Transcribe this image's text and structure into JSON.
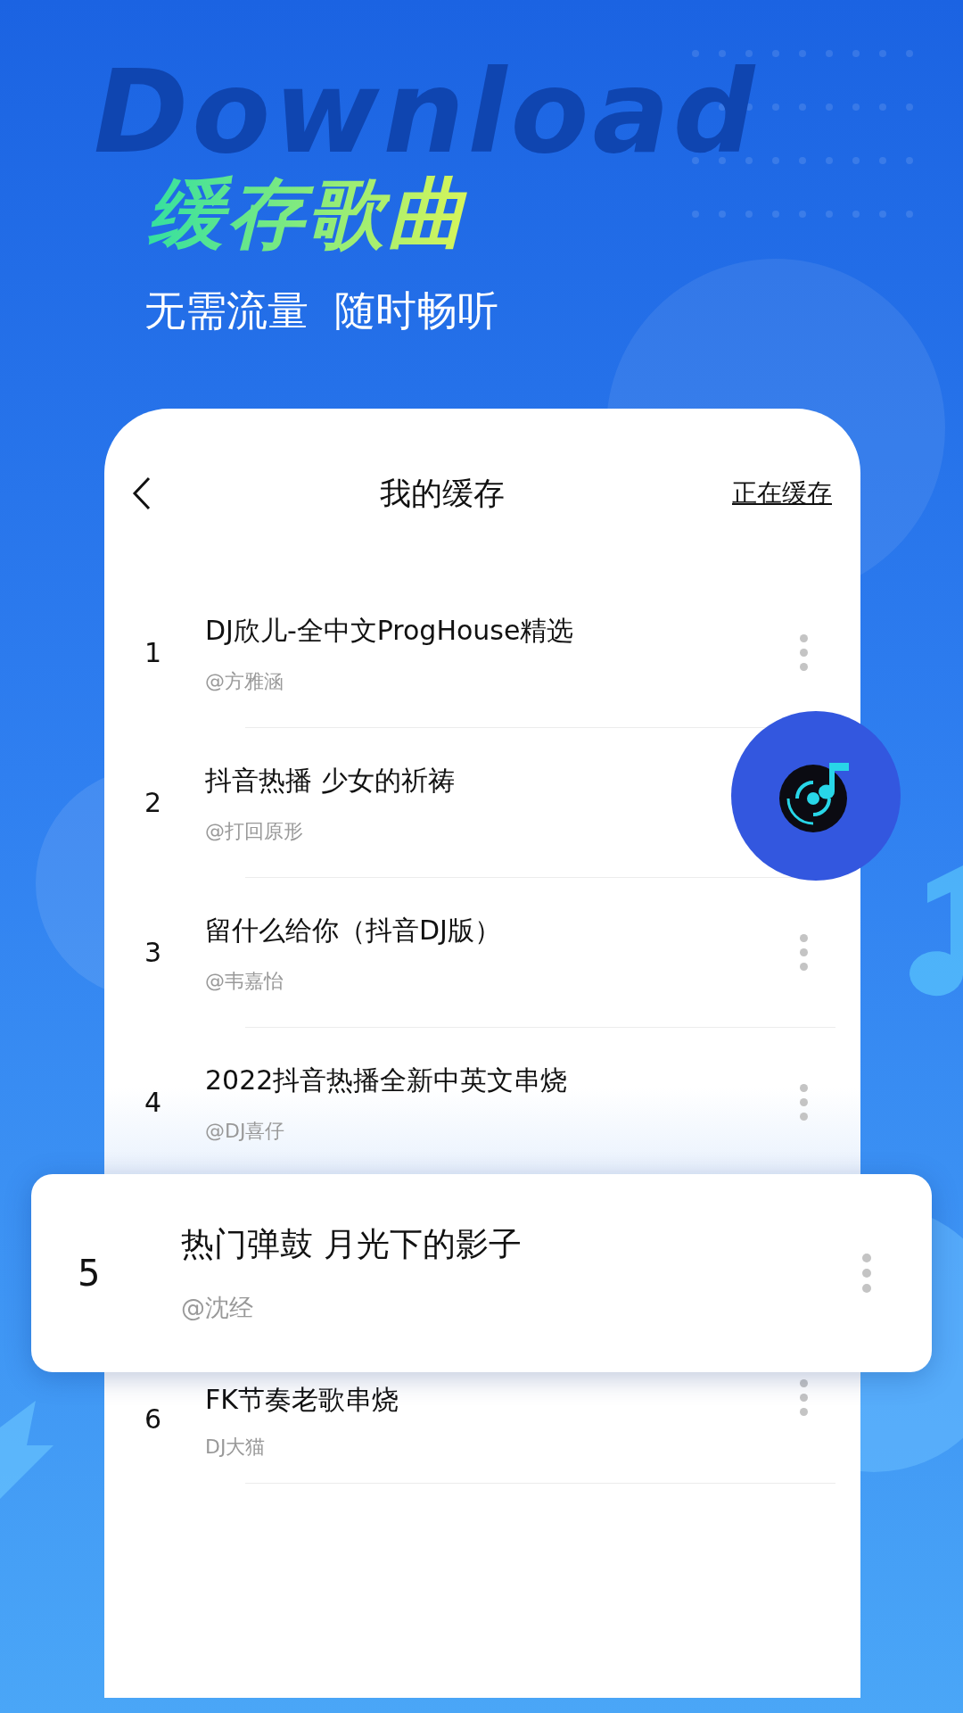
{
  "background_text": "Download",
  "headline": "缓存歌曲",
  "tagline": "无需流量  随时畅听",
  "screen": {
    "title": "我的缓存",
    "action": "正在缓存"
  },
  "songs": [
    {
      "rank": "1",
      "title": "DJ欣儿-全中文ProgHouse精选",
      "artist": "@方雅涵",
      "raised": false
    },
    {
      "rank": "2",
      "title": "抖音热播  少女的祈祷",
      "artist": "@打回原形",
      "raised": false
    },
    {
      "rank": "3",
      "title": "留什么给你（抖音DJ版）",
      "artist": "@韦嘉怡",
      "raised": false
    },
    {
      "rank": "4",
      "title": "2022抖音热播全新中英文串烧",
      "artist": "@DJ喜仔",
      "raised": false
    },
    {
      "rank": "5",
      "title": "热门弹鼓 月光下的影子",
      "artist": "@沈经",
      "raised": true
    },
    {
      "rank": "6",
      "title": "FK节奏老歌串烧",
      "artist": "DJ大猫",
      "raised": false
    }
  ]
}
